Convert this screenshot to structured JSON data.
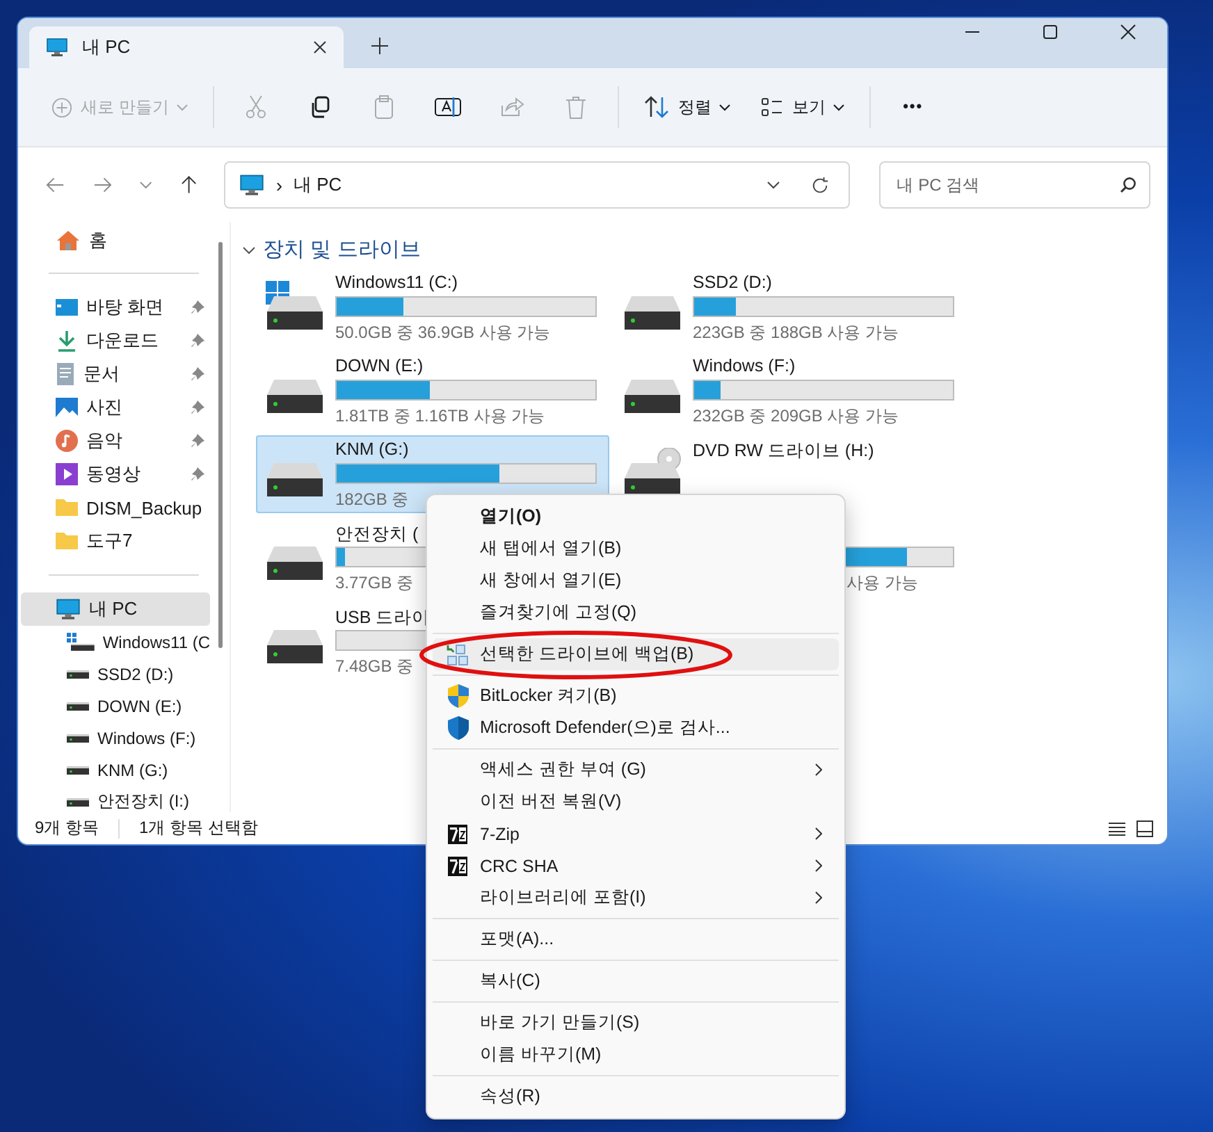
{
  "tabs": [
    {
      "label": "내 PC",
      "selected": true
    }
  ],
  "toolbar": [
    {
      "kind": "new",
      "label": "새로 만들기",
      "disabled": true
    },
    {
      "kind": "cut",
      "disabled": true
    },
    {
      "kind": "copy",
      "disabled": false
    },
    {
      "kind": "paste",
      "disabled": true
    },
    {
      "kind": "rename",
      "disabled": false
    },
    {
      "kind": "share",
      "disabled": true
    },
    {
      "kind": "delete",
      "disabled": true
    },
    {
      "kind": "sort",
      "label": "정렬",
      "disabled": false
    },
    {
      "kind": "view",
      "label": "보기",
      "disabled": false
    },
    {
      "kind": "more",
      "label": "•••",
      "disabled": false
    }
  ],
  "address": {
    "path": "내 PC",
    "separator": "›"
  },
  "search": {
    "placeholder": "내 PC 검색"
  },
  "sidebar": {
    "items": [
      {
        "kind": "home",
        "label": "홈",
        "pinned": false,
        "selected": false
      },
      {
        "kind": "divider"
      },
      {
        "kind": "desktop",
        "label": "바탕 화면",
        "pinned": true,
        "selected": false
      },
      {
        "kind": "download",
        "label": "다운로드",
        "pinned": true,
        "selected": false
      },
      {
        "kind": "documents",
        "label": "문서",
        "pinned": true,
        "selected": false
      },
      {
        "kind": "pictures",
        "label": "사진",
        "pinned": true,
        "selected": false
      },
      {
        "kind": "music",
        "label": "음악",
        "pinned": true,
        "selected": false
      },
      {
        "kind": "videos",
        "label": "동영상",
        "pinned": true,
        "selected": false
      },
      {
        "kind": "folder",
        "label": "DISM_Backup",
        "pinned": false,
        "selected": false
      },
      {
        "kind": "folder",
        "label": "도구7",
        "pinned": false,
        "selected": false
      },
      {
        "kind": "divider"
      },
      {
        "kind": "pc",
        "label": "내 PC",
        "pinned": false,
        "selected": true,
        "children": [
          {
            "kind": "windows-drive",
            "label": "Windows11 (C"
          },
          {
            "kind": "drive",
            "label": "SSD2 (D:)"
          },
          {
            "kind": "drive",
            "label": "DOWN (E:)"
          },
          {
            "kind": "drive",
            "label": "Windows (F:)"
          },
          {
            "kind": "drive",
            "label": "KNM (G:)"
          },
          {
            "kind": "drive",
            "label": "안전장치 (I:)"
          }
        ]
      }
    ]
  },
  "section": {
    "title": "장치 및 드라이브",
    "expanded": true
  },
  "drives": [
    {
      "kind": "windows",
      "name": "Windows11 (C:)",
      "level": 0.26,
      "info": "50.0GB 중 36.9GB 사용 가능",
      "selected": false
    },
    {
      "kind": "hdd",
      "name": "SSD2 (D:)",
      "level": 0.16,
      "info": "223GB 중 188GB 사용 가능",
      "selected": false
    },
    {
      "kind": "hdd",
      "name": "DOWN (E:)",
      "level": 0.36,
      "info": "1.81TB 중 1.16TB 사용 가능",
      "selected": false
    },
    {
      "kind": "hdd",
      "name": "Windows (F:)",
      "level": 0.1,
      "info": "232GB 중 209GB 사용 가능",
      "selected": false
    },
    {
      "kind": "hdd",
      "name": "KNM (G:)",
      "level": 0.63,
      "info": "182GB 중",
      "selected": true
    },
    {
      "kind": "dvd",
      "name": "DVD RW 드라이브 (H:)",
      "selected": false
    },
    {
      "kind": "hdd",
      "name": "안전장치 (",
      "level": 0.03,
      "info": "3.77GB 중",
      "selected": false
    },
    {
      "kind": "covered",
      "level": 0.82,
      "info": "사용 가능",
      "selected": false
    },
    {
      "kind": "hdd",
      "name": "USB 드라이",
      "level": 0.0,
      "info": "7.48GB 중",
      "selected": false
    }
  ],
  "status_bar": {
    "count": "9개 항목",
    "selection": "1개 항목 선택함"
  },
  "context_menu": {
    "items": [
      {
        "kind": "item",
        "label": "열기(O)",
        "default": true,
        "selected": false,
        "submenu": false
      },
      {
        "kind": "item",
        "label": "새 탭에서 열기(B)",
        "default": false,
        "selected": false,
        "submenu": false
      },
      {
        "kind": "item",
        "label": "새 창에서 열기(E)",
        "default": false,
        "selected": false,
        "submenu": false
      },
      {
        "kind": "item",
        "label": "즐겨찾기에 고정(Q)",
        "default": false,
        "selected": false,
        "submenu": false
      },
      {
        "kind": "separator"
      },
      {
        "kind": "backup",
        "label": "선택한 드라이브에 백업(B)",
        "default": false,
        "selected": true,
        "submenu": false,
        "annotated": true
      },
      {
        "kind": "separator"
      },
      {
        "kind": "bitlocker",
        "label": "BitLocker 켜기(B)",
        "default": false,
        "selected": false,
        "submenu": false
      },
      {
        "kind": "defender",
        "label": "Microsoft Defender(으)로 검사...",
        "default": false,
        "selected": false,
        "submenu": false
      },
      {
        "kind": "separator"
      },
      {
        "kind": "item",
        "label": "액세스 권한 부여 (G)",
        "default": false,
        "selected": false,
        "submenu": true
      },
      {
        "kind": "item",
        "label": "이전 버전 복원(V)",
        "default": false,
        "selected": false,
        "submenu": false
      },
      {
        "kind": "archive",
        "label": "7-Zip",
        "default": false,
        "selected": false,
        "submenu": true
      },
      {
        "kind": "archive",
        "label": "CRC SHA",
        "default": false,
        "selected": false,
        "submenu": true
      },
      {
        "kind": "item",
        "label": "라이브러리에 포함(I)",
        "default": false,
        "selected": false,
        "submenu": true
      },
      {
        "kind": "separator"
      },
      {
        "kind": "item",
        "label": "포맷(A)...",
        "default": false,
        "selected": false,
        "submenu": false
      },
      {
        "kind": "separator"
      },
      {
        "kind": "item",
        "label": "복사(C)",
        "default": false,
        "selected": false,
        "submenu": false
      },
      {
        "kind": "separator"
      },
      {
        "kind": "item",
        "label": "바로 가기 만들기(S)",
        "default": false,
        "selected": false,
        "submenu": false
      },
      {
        "kind": "item",
        "label": "이름 바꾸기(M)",
        "default": false,
        "selected": false,
        "submenu": false
      },
      {
        "kind": "separator"
      },
      {
        "kind": "item",
        "label": "속성(R)",
        "default": false,
        "selected": false,
        "submenu": false
      }
    ]
  }
}
